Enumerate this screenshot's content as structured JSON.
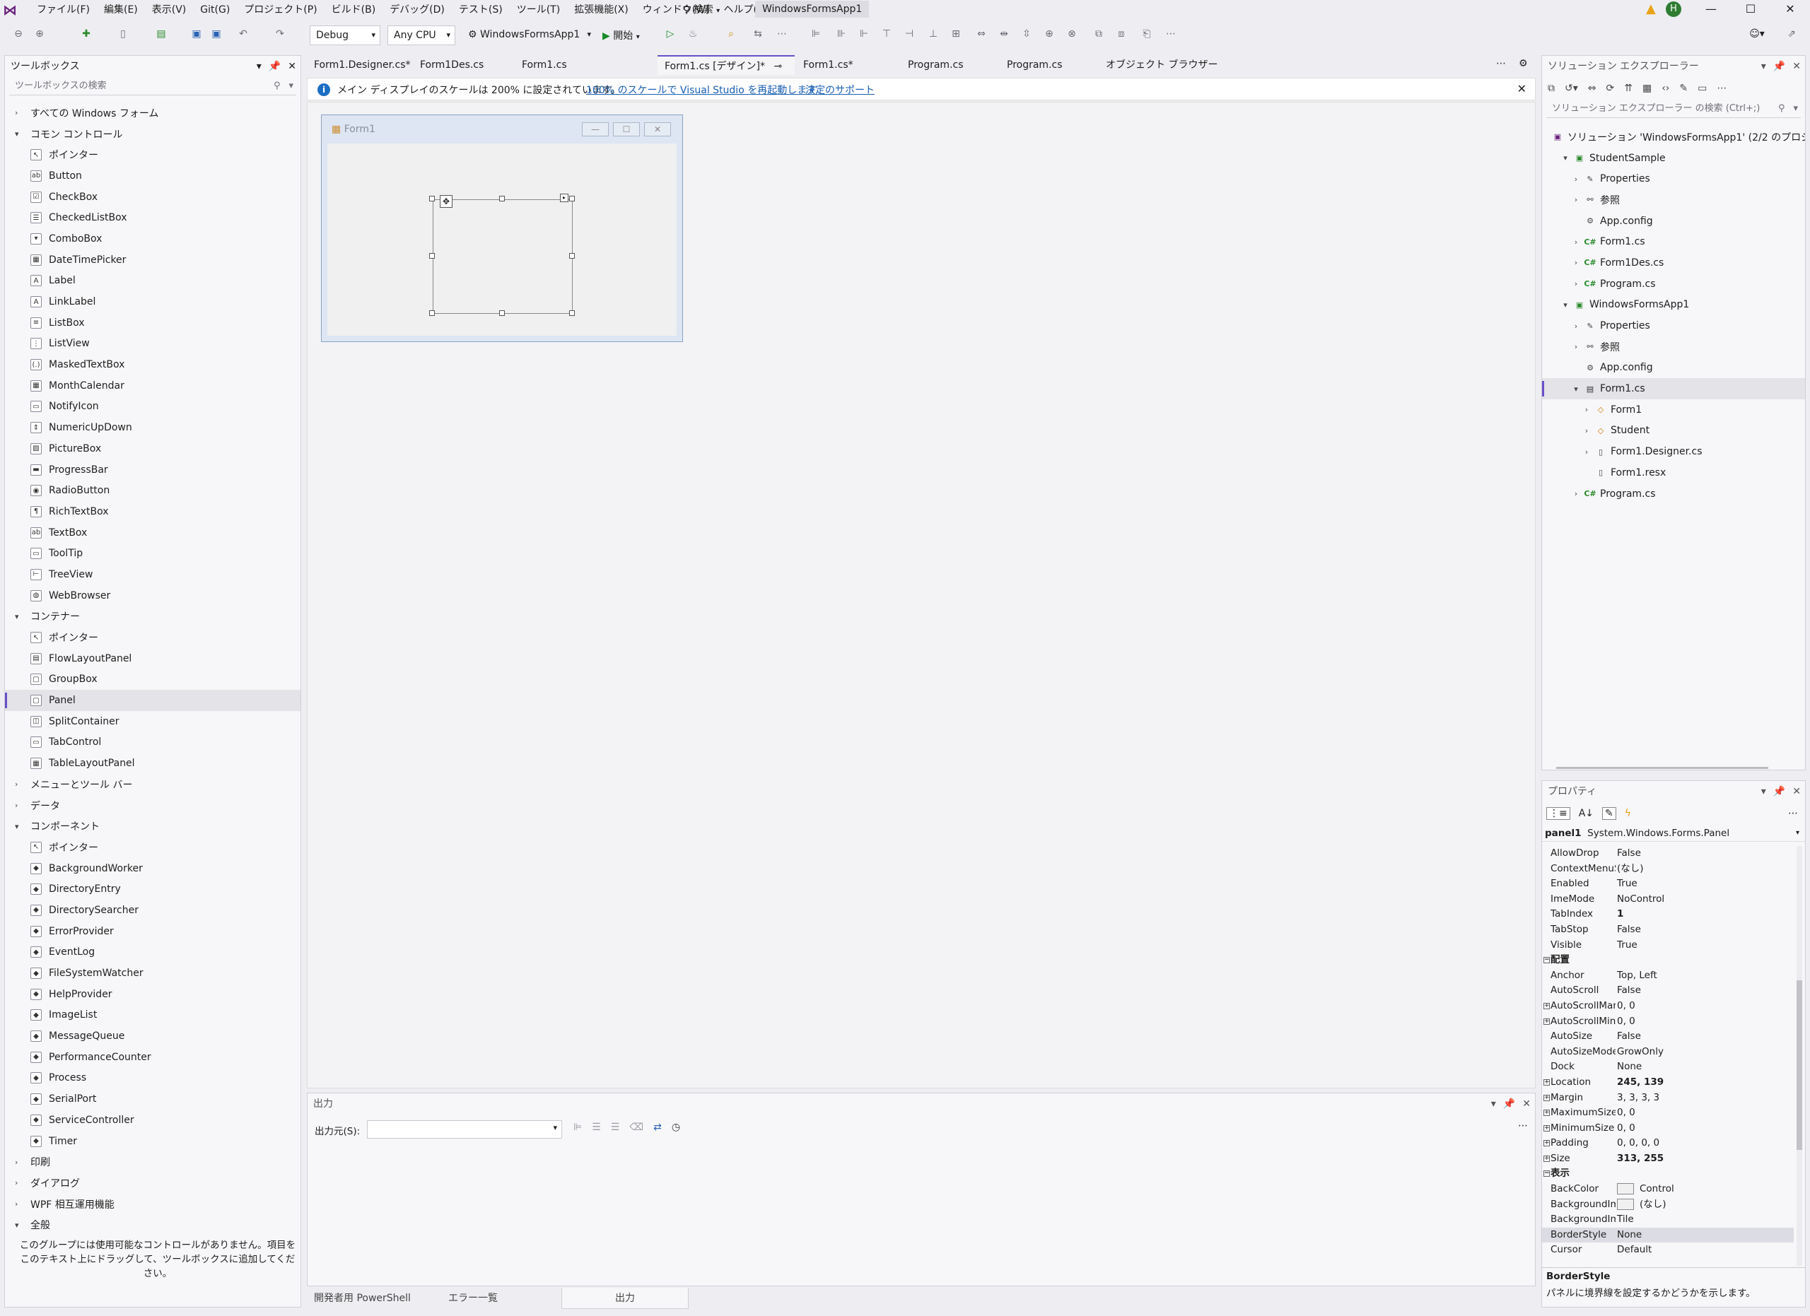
{
  "menubar": {
    "items": [
      "ファイル(F)",
      "編集(E)",
      "表示(V)",
      "Git(G)",
      "プロジェクト(P)",
      "ビルド(B)",
      "デバッグ(D)",
      "テスト(S)",
      "ツール(T)",
      "拡張機能(X)",
      "ウィンドウ(W)",
      "ヘルプ(H)"
    ],
    "search": "検索",
    "window_title": "WindowsFormsApp1",
    "user_initial": "H"
  },
  "toolbar": {
    "config": "Debug",
    "platform": "Any CPU",
    "startup_project": "WindowsFormsApp1",
    "start_label": "開始"
  },
  "toolbox": {
    "title": "ツールボックス",
    "search_placeholder": "ツールボックスの検索",
    "groups": [
      {
        "label": "すべての Windows フォーム",
        "expanded": false,
        "items": []
      },
      {
        "label": "コモン コントロール",
        "expanded": true,
        "items": [
          "ポインター",
          "Button",
          "CheckBox",
          "CheckedListBox",
          "ComboBox",
          "DateTimePicker",
          "Label",
          "LinkLabel",
          "ListBox",
          "ListView",
          "MaskedTextBox",
          "MonthCalendar",
          "NotifyIcon",
          "NumericUpDown",
          "PictureBox",
          "ProgressBar",
          "RadioButton",
          "RichTextBox",
          "TextBox",
          "ToolTip",
          "TreeView",
          "WebBrowser"
        ]
      },
      {
        "label": "コンテナー",
        "expanded": true,
        "items": [
          "ポインター",
          "FlowLayoutPanel",
          "GroupBox",
          "Panel",
          "SplitContainer",
          "TabControl",
          "TableLayoutPanel"
        ]
      },
      {
        "label": "メニューとツール バー",
        "expanded": false,
        "items": []
      },
      {
        "label": "データ",
        "expanded": false,
        "items": []
      },
      {
        "label": "コンポーネント",
        "expanded": true,
        "items": [
          "ポインター",
          "BackgroundWorker",
          "DirectoryEntry",
          "DirectorySearcher",
          "ErrorProvider",
          "EventLog",
          "FileSystemWatcher",
          "HelpProvider",
          "ImageList",
          "MessageQueue",
          "PerformanceCounter",
          "Process",
          "SerialPort",
          "ServiceController",
          "Timer"
        ]
      },
      {
        "label": "印刷",
        "expanded": false,
        "items": []
      },
      {
        "label": "ダイアログ",
        "expanded": false,
        "items": []
      },
      {
        "label": "WPF 相互運用機能",
        "expanded": false,
        "items": []
      },
      {
        "label": "全般",
        "expanded": true,
        "items": []
      }
    ],
    "selected_item": "Panel",
    "empty_note": "このグループには使用可能なコントロールがありません。項目をこのテキスト上にドラッグして、ツールボックスに追加してください。"
  },
  "doc_tabs": [
    "Form1.Designer.cs*",
    "Form1Des.cs",
    "Form1.cs",
    "Form1.cs [デザイン]*",
    "Form1.cs*",
    "Program.cs",
    "Program.cs",
    "オブジェクト ブラウザー"
  ],
  "active_tab": "Form1.cs [デザイン]*",
  "infobar": {
    "message": "メイン ディスプレイのスケールは 200% に設定されています。",
    "link1": "100% のスケールで Visual Studio を再起動します",
    "link2": "決定のサポート"
  },
  "form": {
    "title": "Form1"
  },
  "output": {
    "title": "出力",
    "source_label": "出力元(S):",
    "source_value": ""
  },
  "bottom_tabs": [
    "開発者用 PowerShell",
    "エラー一覧",
    "出力"
  ],
  "active_bottom_tab": "出力",
  "solution_explorer": {
    "title": "ソリューション エクスプローラー",
    "search_placeholder": "ソリューション エクスプローラー の検索 (Ctrl+;)",
    "nodes": [
      {
        "label": "ソリューション 'WindowsFormsApp1' (2/2 のプロジェクト)",
        "depth": 0,
        "arrow": "",
        "icon": "solution-icon",
        "glyph": "▣"
      },
      {
        "label": "StudentSample",
        "depth": 1,
        "arrow": "▾",
        "icon": "csproj-icon",
        "glyph": "▣"
      },
      {
        "label": "Properties",
        "depth": 2,
        "arrow": "›",
        "icon": "wrench-icon",
        "glyph": "✎"
      },
      {
        "label": "参照",
        "depth": 2,
        "arrow": "›",
        "icon": "references-icon",
        "glyph": "⚯"
      },
      {
        "label": "App.config",
        "depth": 2,
        "arrow": "",
        "icon": "config-icon",
        "glyph": "⚙"
      },
      {
        "label": "Form1.cs",
        "depth": 2,
        "arrow": "›",
        "icon": "csharp-file-icon",
        "glyph": "C#"
      },
      {
        "label": "Form1Des.cs",
        "depth": 2,
        "arrow": "›",
        "icon": "csharp-file-icon",
        "glyph": "C#"
      },
      {
        "label": "Program.cs",
        "depth": 2,
        "arrow": "›",
        "icon": "csharp-file-icon",
        "glyph": "C#"
      },
      {
        "label": "WindowsFormsApp1",
        "depth": 1,
        "arrow": "▾",
        "icon": "csproj-icon",
        "glyph": "▣"
      },
      {
        "label": "Properties",
        "depth": 2,
        "arrow": "›",
        "icon": "wrench-icon",
        "glyph": "✎"
      },
      {
        "label": "参照",
        "depth": 2,
        "arrow": "›",
        "icon": "references-icon",
        "glyph": "⚯"
      },
      {
        "label": "App.config",
        "depth": 2,
        "arrow": "",
        "icon": "config-icon",
        "glyph": "⚙"
      },
      {
        "label": "Form1.cs",
        "depth": 2,
        "arrow": "▾",
        "icon": "form-icon",
        "glyph": "▤"
      },
      {
        "label": "Form1",
        "depth": 3,
        "arrow": "›",
        "icon": "class-icon",
        "glyph": "◇"
      },
      {
        "label": "Student",
        "depth": 3,
        "arrow": "›",
        "icon": "class-icon",
        "glyph": "◇"
      },
      {
        "label": "Form1.Designer.cs",
        "depth": 3,
        "arrow": "›",
        "icon": "file-icon",
        "glyph": "▯"
      },
      {
        "label": "Form1.resx",
        "depth": 3,
        "arrow": "",
        "icon": "file-icon",
        "glyph": "▯"
      },
      {
        "label": "Program.cs",
        "depth": 2,
        "arrow": "›",
        "icon": "csharp-file-icon",
        "glyph": "C#"
      }
    ],
    "selected": "Form1.cs"
  },
  "properties": {
    "title": "プロパティ",
    "object_name": "panel1",
    "object_type": "System.Windows.Forms.Panel",
    "rows": [
      {
        "n": "AllowDrop",
        "v": "False"
      },
      {
        "n": "ContextMenuSt",
        "v": "(なし)"
      },
      {
        "n": "Enabled",
        "v": "True"
      },
      {
        "n": "ImeMode",
        "v": "NoControl"
      },
      {
        "n": "TabIndex",
        "v": "1",
        "bold": true
      },
      {
        "n": "TabStop",
        "v": "False"
      },
      {
        "n": "Visible",
        "v": "True"
      },
      {
        "n": "配置",
        "v": "",
        "cat": true
      },
      {
        "n": "Anchor",
        "v": "Top, Left"
      },
      {
        "n": "AutoScroll",
        "v": "False"
      },
      {
        "n": "AutoScrollMarg",
        "v": "0, 0",
        "exp": true
      },
      {
        "n": "AutoScrollMinS",
        "v": "0, 0",
        "exp": true
      },
      {
        "n": "AutoSize",
        "v": "False"
      },
      {
        "n": "AutoSizeMode",
        "v": "GrowOnly"
      },
      {
        "n": "Dock",
        "v": "None"
      },
      {
        "n": "Location",
        "v": "245, 139",
        "exp": true,
        "bold": true
      },
      {
        "n": "Margin",
        "v": "3, 3, 3, 3",
        "exp": true
      },
      {
        "n": "MaximumSize",
        "v": "0, 0",
        "exp": true
      },
      {
        "n": "MinimumSize",
        "v": "0, 0",
        "exp": true
      },
      {
        "n": "Padding",
        "v": "0, 0, 0, 0",
        "exp": true
      },
      {
        "n": "Size",
        "v": "313, 255",
        "exp": true,
        "bold": true
      },
      {
        "n": "表示",
        "v": "",
        "cat": true
      },
      {
        "n": "BackColor",
        "v": "Control",
        "swatch": true
      },
      {
        "n": "BackgroundIma",
        "v": "(なし)",
        "swatch": true
      },
      {
        "n": "BackgroundIma",
        "v": "Tile"
      },
      {
        "n": "BorderStyle",
        "v": "None",
        "sel": true
      },
      {
        "n": "Cursor",
        "v": "Default"
      }
    ],
    "desc_title": "BorderStyle",
    "desc_text": "パネルに境界線を設定するかどうかを示します。"
  },
  "colors": {
    "accent": "#6a4fc9",
    "link": "#1a5fb4",
    "start_green": "#1a8a2a"
  }
}
